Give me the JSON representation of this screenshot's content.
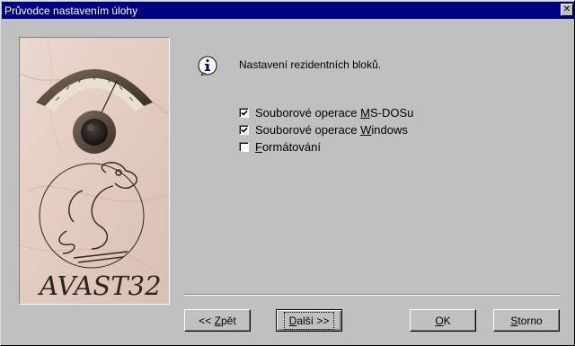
{
  "window": {
    "title": "Průvodce nastavením úlohy"
  },
  "art": {
    "brand_text": "AVAST32"
  },
  "content": {
    "heading": "Nastavení rezidentních bloků.",
    "options": [
      {
        "pre": "Souborové operace ",
        "key": "M",
        "post": "S-DOSu",
        "checked": true
      },
      {
        "pre": "Souborové operace ",
        "key": "W",
        "post": "indows",
        "checked": true
      },
      {
        "pre": "",
        "key": "F",
        "post": "ormátování",
        "checked": false
      }
    ]
  },
  "buttons": {
    "back": {
      "pre": "<< ",
      "key": "Z",
      "post": "pět"
    },
    "next": {
      "pre": "",
      "key": "D",
      "post": "alší >>"
    },
    "ok": {
      "pre": "",
      "key": "O",
      "post": "K"
    },
    "cancel": {
      "pre": "",
      "key": "S",
      "post": "torno"
    }
  },
  "colors": {
    "titlebar": "#000080",
    "dialog_bg": "#c0c0c0",
    "marble": "#ead8cf"
  }
}
